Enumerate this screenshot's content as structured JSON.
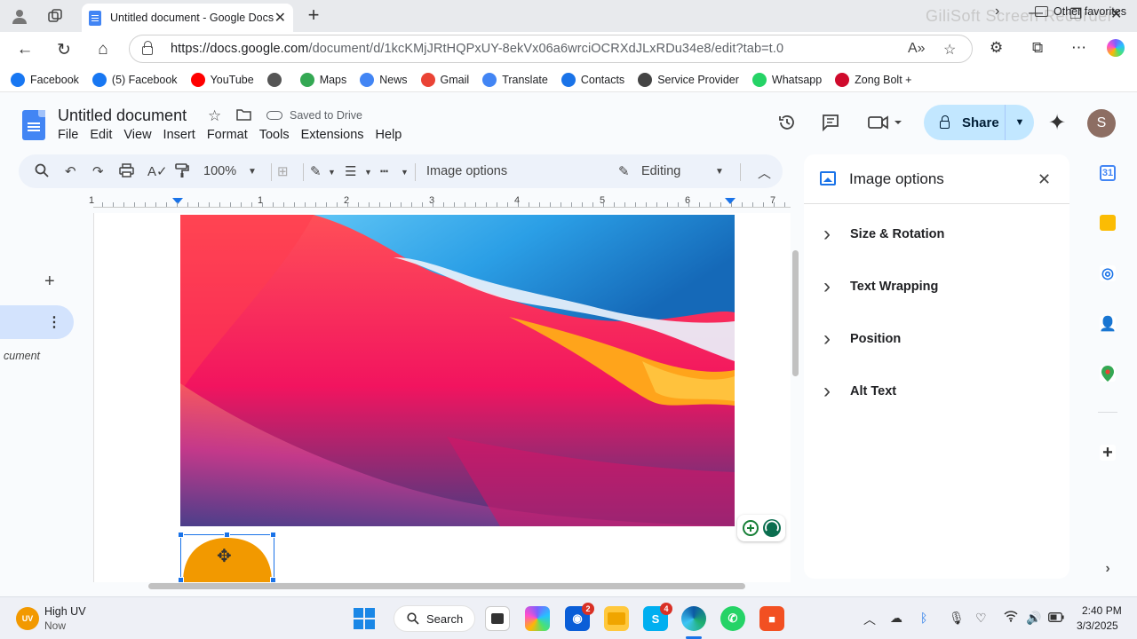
{
  "browser": {
    "tab_title": "Untitled document - Google Docs",
    "watermark": "GiliSoft Screen Recorder",
    "url_domain": "https://docs.google.com",
    "url_path": "/document/d/1kcKMjJRtHQPxUY-8ekVx06a6wrciOCRXdJLxRDu34e8/edit?tab=t.0",
    "bookmarks": [
      {
        "label": "Facebook",
        "icon": "facebook-icon",
        "color": "#1877f2"
      },
      {
        "label": "(5) Facebook",
        "icon": "facebook-icon",
        "color": "#1877f2"
      },
      {
        "label": "YouTube",
        "icon": "youtube-icon",
        "color": "#ff0000"
      },
      {
        "label": "",
        "icon": "globe-icon",
        "color": "#555555"
      },
      {
        "label": "Maps",
        "icon": "maps-icon",
        "color": "#34a853"
      },
      {
        "label": "News",
        "icon": "news-icon",
        "color": "#4285f4"
      },
      {
        "label": "Gmail",
        "icon": "gmail-icon",
        "color": "#ea4335"
      },
      {
        "label": "Translate",
        "icon": "translate-icon",
        "color": "#4285f4"
      },
      {
        "label": "Contacts",
        "icon": "contacts-icon",
        "color": "#1a73e8"
      },
      {
        "label": "Service Provider",
        "icon": "service-icon",
        "color": "#444444"
      },
      {
        "label": "Whatsapp",
        "icon": "whatsapp-icon",
        "color": "#25d366"
      },
      {
        "label": "Zong Bolt +",
        "icon": "huawei-icon",
        "color": "#cf0a2c"
      }
    ],
    "other_favorites": "Other favorites"
  },
  "docs": {
    "title": "Untitled document",
    "saved_status": "Saved to Drive",
    "menu": [
      "File",
      "Edit",
      "View",
      "Insert",
      "Format",
      "Tools",
      "Extensions",
      "Help"
    ],
    "share_label": "Share",
    "avatar_letter": "S",
    "toolbar": {
      "zoom": "100%",
      "image_options": "Image options",
      "mode": "Editing"
    },
    "ruler_numbers": [
      "1",
      "1",
      "2",
      "3",
      "4",
      "5",
      "6",
      "7"
    ],
    "outline_text": "cument"
  },
  "side_panel": {
    "title": "Image options",
    "sections": [
      "Size & Rotation",
      "Text Wrapping",
      "Position",
      "Alt Text"
    ]
  },
  "taskbar": {
    "weather_badge": "UV",
    "weather_title": "High UV",
    "weather_sub": "Now",
    "search_label": "Search",
    "badge_copilot": "2",
    "badge_skype": "4",
    "time": "2:40 PM",
    "date": "3/3/2025"
  },
  "colors": {
    "accent": "#1a73e8",
    "share_bg": "#c2e7ff",
    "toolbar_bg": "#edf2fa",
    "shape_fill": "#f29900"
  }
}
